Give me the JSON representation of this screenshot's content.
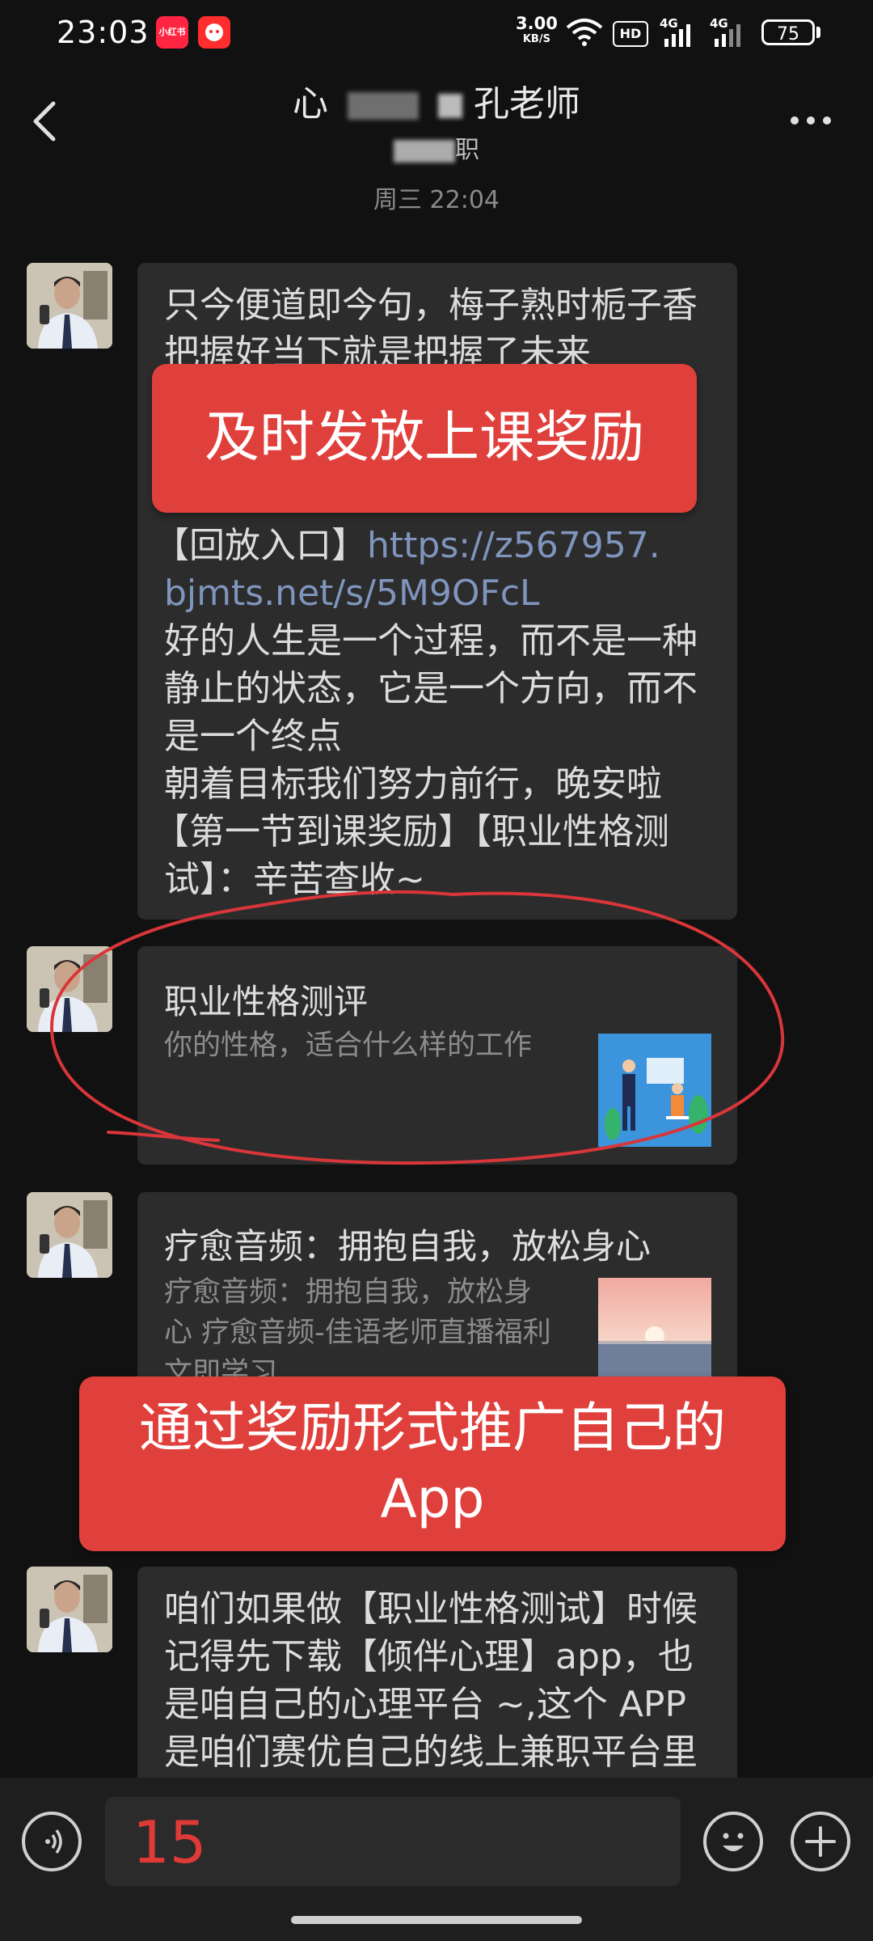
{
  "status_bar": {
    "time": "23:03",
    "app_badges": [
      "小红书",
      "app"
    ],
    "net_speed_value": "3.00",
    "net_speed_unit": "KB/S",
    "hd_label": "HD",
    "signal_1": "4G",
    "signal_2": "4G",
    "battery": "75"
  },
  "header": {
    "title_left": "心",
    "title_right": "孔老师",
    "subtitle_right": "职",
    "timestamp": "周三 22:04"
  },
  "messages": {
    "m1": {
      "line1": "只今便道即今句，梅子熟时栀子香",
      "line2": "把握好当下就是把握了未来",
      "replay_prefix": "【回放入口】",
      "link_line1": "https://z567957.",
      "link_line2": "bjmts.net/s/5M9OFcL",
      "p1_l1": "好的人生是一个过程，而不是一种",
      "p1_l2": "静止的状态，它是一个方向，而不",
      "p1_l3": "是一个终点",
      "p2": "朝着目标我们努力前行，晚安啦",
      "p3_l1": "【第一节到课奖励】【职业性格测",
      "p3_l2": "试】：辛苦查收~"
    },
    "card1": {
      "title": "职业性格测评",
      "desc": "你的性格，适合什么样的工作"
    },
    "card2": {
      "title": "疗愈音频：拥抱自我，放松身心",
      "desc_l1": "疗愈音频：拥抱自我，放松身",
      "desc_l2": "心 疗愈音频-佳语老师直播福利",
      "desc_l3": "文即学习"
    },
    "m4": {
      "l1": "咱们如果做【职业性格测试】时候",
      "l2": "记得先下载【倾伴心理】app，也",
      "l3": "是咱自己的心理平台 ~,这个 APP",
      "l4": "是咱们赛优自己的线上兼职平台里"
    }
  },
  "annotations": {
    "label1": "及时发放上课奖励",
    "label2_l1": "通过奖励形式推广自己的",
    "label2_l2": "App"
  },
  "input": {
    "value": "15"
  },
  "colors": {
    "background": "#111111",
    "bubble": "#2c2c2c",
    "link": "#7f95bd",
    "annotation_red": "#e0403c",
    "circle_red": "#d8363a"
  },
  "icons": [
    "back-arrow-icon",
    "more-icon",
    "voice-icon",
    "emoji-icon",
    "plus-icon",
    "wifi-icon",
    "signal-icon",
    "battery-icon"
  ]
}
